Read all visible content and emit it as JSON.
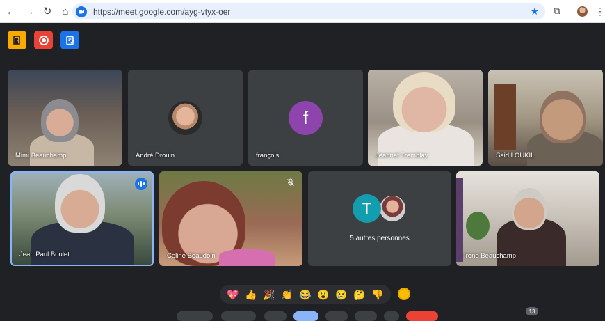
{
  "browser": {
    "url": "https://meet.google.com/ayg-vtyx-oer",
    "back_glyph": "←",
    "forward_glyph": "→",
    "reload_glyph": "↻",
    "home_glyph": "⌂",
    "star_glyph": "★",
    "ext_glyph": "⧉",
    "menu_glyph": "⋮"
  },
  "tiles": [
    {
      "name": "Mimi Beauchamp"
    },
    {
      "name": "André Drouin"
    },
    {
      "name": "françois",
      "initial": "f"
    },
    {
      "name": "Jeannet Tremblay"
    },
    {
      "name": "Said LOUKIL"
    },
    {
      "name": "Jean Paul Boulet"
    },
    {
      "name": "Celine Beaudoin"
    },
    {
      "name": "5 autres personnes",
      "initial": "T"
    },
    {
      "name": "Irene Beauchamp"
    }
  ],
  "reactions": [
    "💖",
    "👍",
    "🎉",
    "👏",
    "😂",
    "😮",
    "😢",
    "🤔",
    "👎"
  ],
  "participants_count": "13",
  "icons": {
    "speaking": "speaking-indicator-icon",
    "mic_off": "mic-off-icon",
    "meet": "meet-video-icon"
  },
  "colors": {
    "background": "#202124",
    "tile": "#3c4043",
    "active_border": "#8ab4f8",
    "avatar_f": "#8e44ad",
    "avatar_t": "#129eaf"
  }
}
